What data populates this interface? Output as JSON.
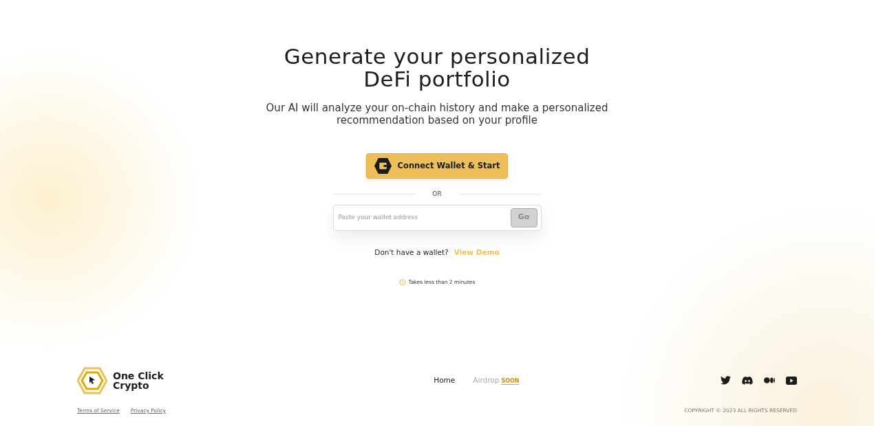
{
  "hero": {
    "title_lines": [
      "Generate your personalized",
      "DeFi portfolio"
    ],
    "subtitle_lines": [
      "Our AI will analyze your on-chain history and make a personalized",
      "recommendation based on your profile"
    ]
  },
  "connect_button": {
    "label": "Connect Wallet & Start"
  },
  "divider_text": "OR",
  "address_form": {
    "placeholder": "Paste your wallet address",
    "button": "Go",
    "disabled": true
  },
  "demo": {
    "text": "Don't have a wallet?",
    "link": "View Demo"
  },
  "time_note": "Takes less than 2 minutes",
  "footer": {
    "brand_lines": [
      "One Click",
      "Crypto"
    ],
    "nav": [
      {
        "label": "Home",
        "disabled": false
      },
      {
        "label": "Airdrop",
        "disabled": true,
        "badge": "SOON"
      }
    ],
    "legal_links": [
      "Terms of Service",
      "Privacy Policy"
    ],
    "social": [
      {
        "kind": "twitter"
      },
      {
        "kind": "discord"
      },
      {
        "kind": "medium"
      },
      {
        "kind": "youtube"
      }
    ],
    "copyright": "COPYRIGHT © 2023 ALL RIGHTS RESERVED"
  }
}
